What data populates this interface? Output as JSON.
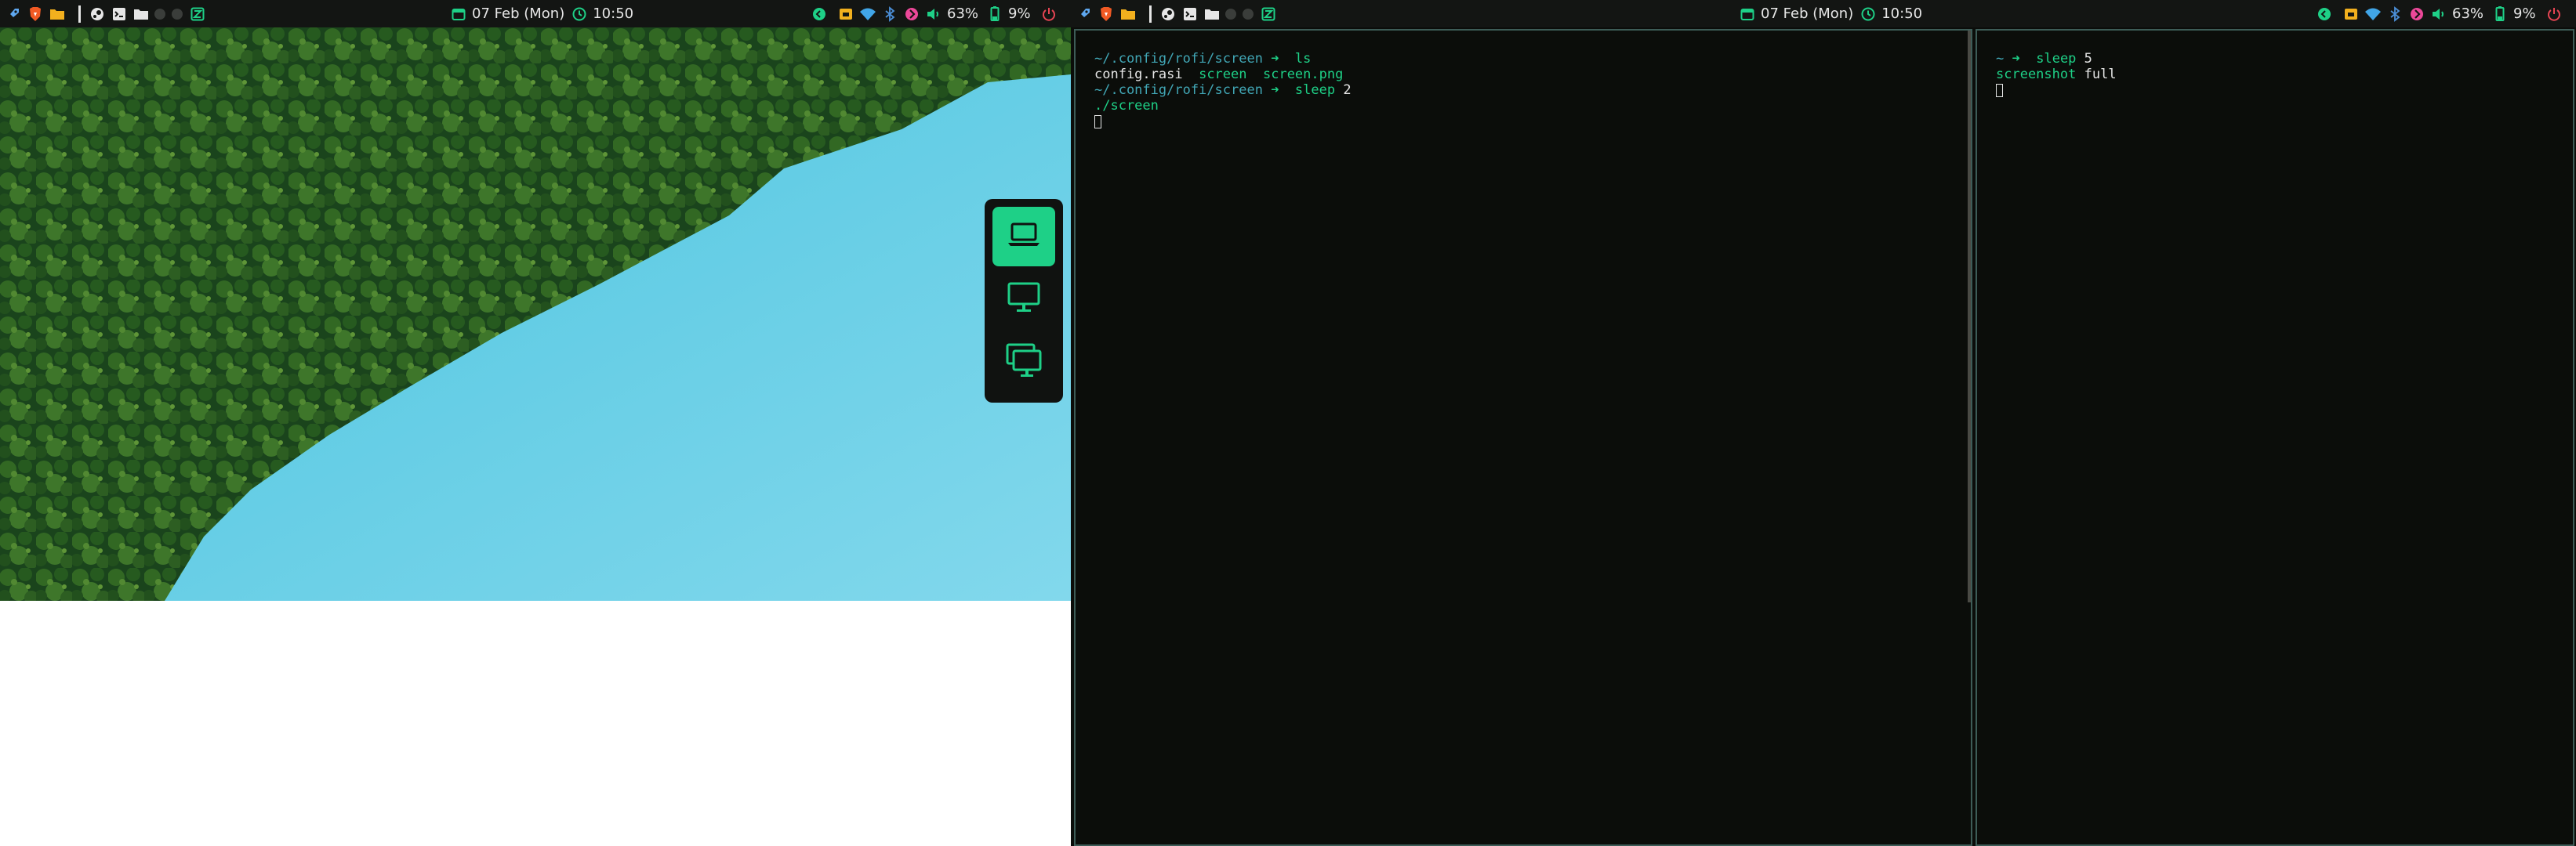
{
  "bars": {
    "date": "07 Feb (Mon)",
    "time": "10:50",
    "volume": "63%",
    "battery": "9%",
    "icons_left": [
      "rocket-icon",
      "brave-browser-icon",
      "folder-icon",
      "steam-icon",
      "terminal-icon",
      "files-icon",
      "workspace-dot-icon",
      "workspace-dot-icon",
      "editor-icon"
    ],
    "icons_right": [
      "green-circle-icon",
      "box-icon",
      "wifi-icon",
      "bluetooth-icon",
      "pink-shield-icon",
      "volume-icon",
      "battery-icon",
      "power-icon"
    ]
  },
  "rofi": {
    "items": [
      "laptop-screen-icon",
      "monitor-icon",
      "dual-monitor-icon"
    ],
    "selected_index": 0
  },
  "terminal1": {
    "prompt1_path": "~/.config/rofi/screen",
    "prompt1_arrow": "➜",
    "prompt1_cmd": "ls",
    "ls_file1": "config.rasi",
    "ls_dir": "screen",
    "ls_file2": "screen.png",
    "prompt2_path": "~/.config/rofi/screen",
    "prompt2_arrow": "➜",
    "prompt2_cmd": "sleep",
    "prompt2_arg": "2",
    "output": "./screen"
  },
  "terminal2": {
    "prompt_path": "~",
    "prompt_arrow": "➜",
    "prompt_cmd": "sleep",
    "prompt_arg": "5",
    "output_word1": "screenshot",
    "output_word2": "full"
  },
  "colors": {
    "accent": "#1ed087",
    "path": "#41a6b5",
    "bar_bg": "#131513",
    "terminal_bg": "#0b0d0a",
    "border": "#3d5c57"
  }
}
